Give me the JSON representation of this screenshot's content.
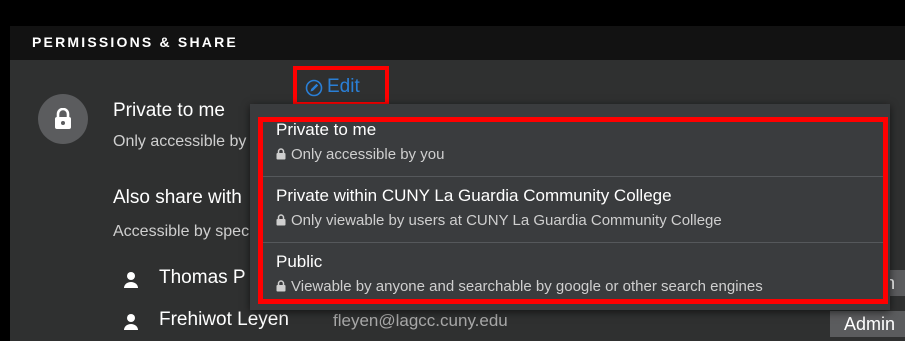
{
  "panel": {
    "title": "PERMISSIONS & SHARE"
  },
  "privacy": {
    "label": "Private to me",
    "sub": "Only accessible by you",
    "edit_label": "Edit"
  },
  "share": {
    "label": "Also share with",
    "sub": "Accessible by specific people"
  },
  "users": [
    {
      "name": "Thomas P",
      "email": "",
      "role": "Admin"
    },
    {
      "name": "Frehiwot Leyen",
      "email": "fleyen@lagcc.cuny.edu",
      "role": "Admin"
    }
  ],
  "dropdown": {
    "options": [
      {
        "title": "Private to me",
        "desc": "Only accessible by you"
      },
      {
        "title": "Private within CUNY La Guardia Community College",
        "desc": "Only viewable by users at CUNY La Guardia Community College"
      },
      {
        "title": "Public",
        "desc": "Viewable by anyone and searchable by google or other search engines"
      }
    ]
  },
  "colors": {
    "accent": "#2a7fd6",
    "highlight": "#ff0000",
    "panel_bg": "#2f3030",
    "menu_bg": "#3a3c3e"
  }
}
